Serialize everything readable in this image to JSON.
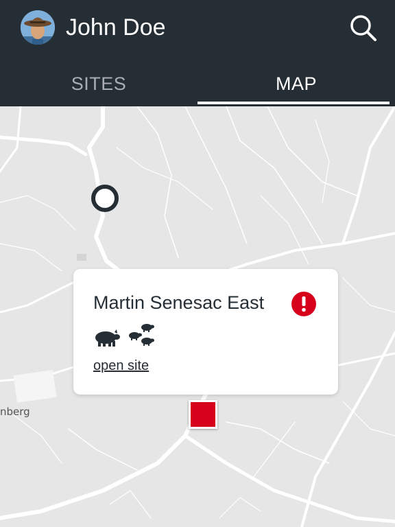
{
  "header": {
    "user_name": "John Doe",
    "avatar_icon": "user-avatar",
    "search_icon": "search-icon",
    "background_color": "#262e35"
  },
  "tabs": [
    {
      "label": "SITES",
      "active": false
    },
    {
      "label": "MAP",
      "active": true
    }
  ],
  "map": {
    "place_label": "nberg",
    "markers": [
      {
        "type": "circle-marker",
        "color": "#262e35"
      },
      {
        "type": "square-marker",
        "color": "#d7001a"
      }
    ]
  },
  "popup": {
    "site_name": "Martin Senesac East",
    "alert_icon": "alert-icon",
    "alert_color": "#d7001a",
    "animal_icons": [
      "sow-icon",
      "piglets-icon"
    ],
    "link_label": "open site"
  }
}
